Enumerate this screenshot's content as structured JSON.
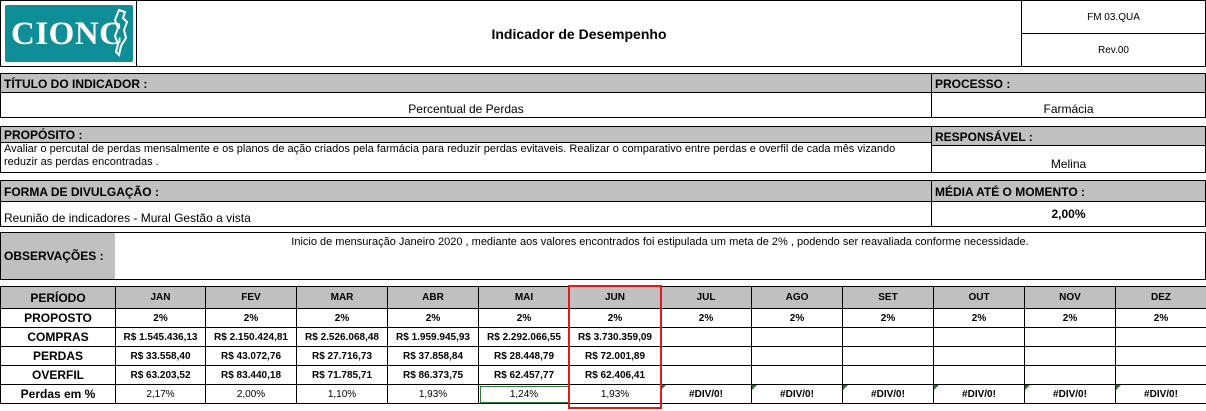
{
  "header": {
    "logo_text": "CIONC",
    "title": "Indicador de Desempenho",
    "code": "FM 03.QUA",
    "revision": "Rev.00"
  },
  "fields": {
    "titulo_label": "TÍTULO DO INDICADOR :",
    "titulo_value": "Percentual de Perdas",
    "processo_label": "PROCESSO :",
    "processo_value": "Farmácia",
    "proposito_label": "PROPÓSITO :",
    "proposito_value": "Avaliar o percutal de perdas mensalmente e os planos de ação criados pela farmácia para reduzir perdas evitaveis. Realizar o comparativo entre perdas e overfil de cada mês vizando reduzir as perdas encontradas .",
    "responsavel_label": "RESPONSÁVEL :",
    "responsavel_value": "Melina",
    "divulgacao_label": "FORMA DE DIVULGAÇÃO :",
    "divulgacao_value": "Reunião de indicadores - Mural Gestão a vista",
    "media_label": "MÉDIA ATÉ O MOMENTO :",
    "media_value": "2,00%",
    "observacoes_label": "OBSERVAÇÕES :",
    "observacoes_value": "Inicio de mensuração Janeiro 2020 , mediante aos valores encontrados foi estipulada um  meta de 2% , podendo ser reavaliada conforme necessidade."
  },
  "table": {
    "row_labels": [
      "PERÍODO",
      "PROPOSTO",
      "COMPRAS",
      "PERDAS",
      "OVERFIL",
      "Perdas em %"
    ],
    "months": [
      "JAN",
      "FEV",
      "MAR",
      "ABR",
      "MAI",
      "JUN",
      "JUL",
      "AGO",
      "SET",
      "OUT",
      "NOV",
      "DEZ"
    ],
    "proposto": [
      "2%",
      "2%",
      "2%",
      "2%",
      "2%",
      "2%",
      "2%",
      "2%",
      "2%",
      "2%",
      "2%",
      "2%"
    ],
    "compras": [
      "R$ 1.545.436,13",
      "R$ 2.150.424,81",
      "R$ 2.526.068,48",
      "R$ 1.959.945,93",
      "R$ 2.292.066,55",
      "R$ 3.730.359,09",
      "",
      "",
      "",
      "",
      "",
      ""
    ],
    "perdas": [
      "R$ 33.558,40",
      "R$ 43.072,76",
      "R$ 27.716,73",
      "R$ 37.858,84",
      "R$ 28.448,79",
      "R$ 72.001,89",
      "",
      "",
      "",
      "",
      "",
      ""
    ],
    "overfil": [
      "R$ 63.203,52",
      "R$ 83.440,18",
      "R$ 71.785,71",
      "R$ 86.373,75",
      "R$ 62.457,77",
      "R$ 62.406,41",
      "",
      "",
      "",
      "",
      "",
      ""
    ],
    "perdas_pct": [
      "2,17%",
      "2,00%",
      "1,10%",
      "1,93%",
      "1,24%",
      "1,93%",
      "#DIV/0!",
      "#DIV/0!",
      "#DIV/0!",
      "#DIV/0!",
      "#DIV/0!",
      "#DIV/0!"
    ]
  },
  "colors": {
    "logo_bg": "#0f8e97",
    "header_gray": "#c0c0c0",
    "highlight_red": "#e01b1b",
    "error_marker_green": "#1e7b34"
  }
}
